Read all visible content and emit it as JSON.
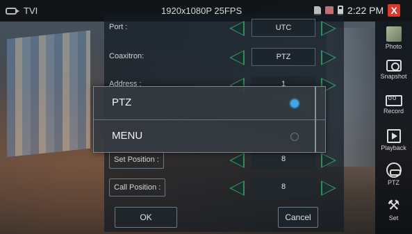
{
  "status_bar": {
    "mode": "TVI",
    "resolution": "1920x1080P 25FPS",
    "time": "2:22 PM",
    "close_label": "X"
  },
  "settings": {
    "rows": [
      {
        "label": "Port :",
        "value": "UTC"
      },
      {
        "label": "Coaxitron:",
        "value": "PTZ"
      },
      {
        "label": "Address :",
        "value": "1"
      },
      {
        "label": "Set Position :",
        "value": "8"
      },
      {
        "label": "Call Position :",
        "value": "8"
      }
    ],
    "ok_label": "OK",
    "cancel_label": "Cancel"
  },
  "popup": {
    "options": [
      {
        "label": "PTZ",
        "selected": true
      },
      {
        "label": "MENU",
        "selected": false
      }
    ],
    "selected_color": "#3fa6e8"
  },
  "toolbar": {
    "items": [
      {
        "label": "Photo",
        "icon": "photo-icon"
      },
      {
        "label": "Snapshot",
        "icon": "camera-icon"
      },
      {
        "label": "Record",
        "icon": "record-icon"
      },
      {
        "label": "Playback",
        "icon": "play-icon"
      },
      {
        "label": "PTZ",
        "icon": "ptz-icon"
      },
      {
        "label": "Set",
        "icon": "tools-icon"
      }
    ]
  },
  "colors": {
    "arrow": "#3cb46e",
    "close": "#d93a2e"
  }
}
